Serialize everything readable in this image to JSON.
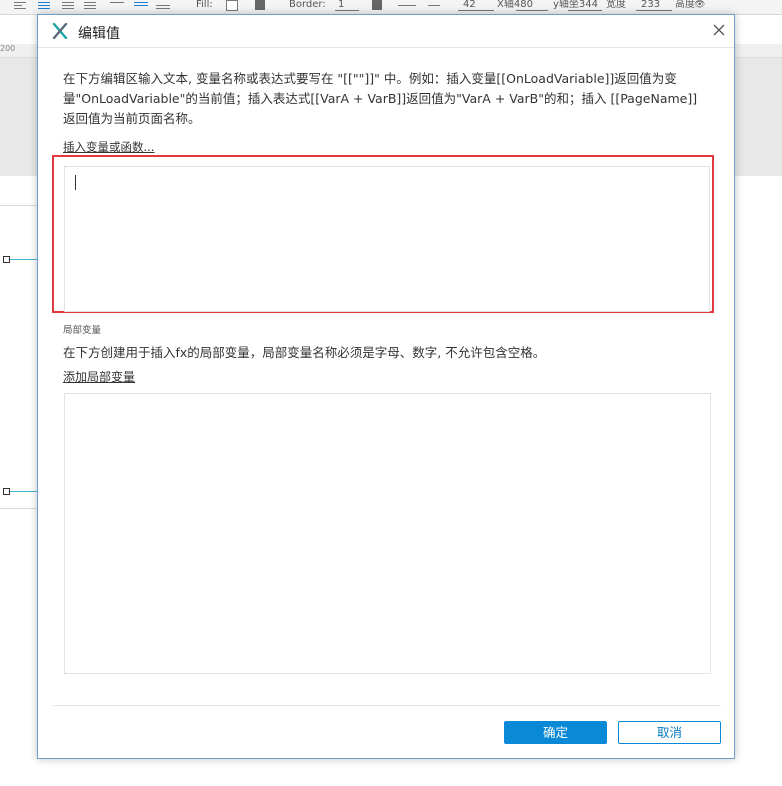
{
  "toolbar": {
    "fill_label": "Fill:",
    "border_label": "Border:",
    "border_value": "1",
    "x_value": "42",
    "x_label": "X轴480",
    "y_label": "y轴坐344",
    "width_label": "宽度",
    "height_value": "233",
    "height_label": "高度"
  },
  "ruler": {
    "mark": "200"
  },
  "dialog": {
    "title": "编辑值",
    "description": "在下方编辑区输入文本, 变量名称或表达式要写在 \"[[\"\"]]\" 中。例如：插入变量[[OnLoadVariable]]返回值为变量\"OnLoadVariable\"的当前值；插入表达式[[VarA + VarB]]返回值为\"VarA + VarB\"的和；插入 [[PageName]] 返回值为当前页面名称。",
    "insert_link": "插入变量或函数...",
    "editor_value": "",
    "local_section_label": "局部变量",
    "local_description": "在下方创建用于插入fx的局部变量，局部变量名称必须是字母、数字, 不允许包含空格。",
    "add_local_link": "添加局部变量",
    "ok_label": "确定",
    "cancel_label": "取消"
  },
  "colors": {
    "accent": "#0a8ad6",
    "highlight": "#e0393e",
    "logo": "#1aa5a5"
  },
  "icons": {
    "logo": "axure-x-icon",
    "close": "close-icon"
  }
}
